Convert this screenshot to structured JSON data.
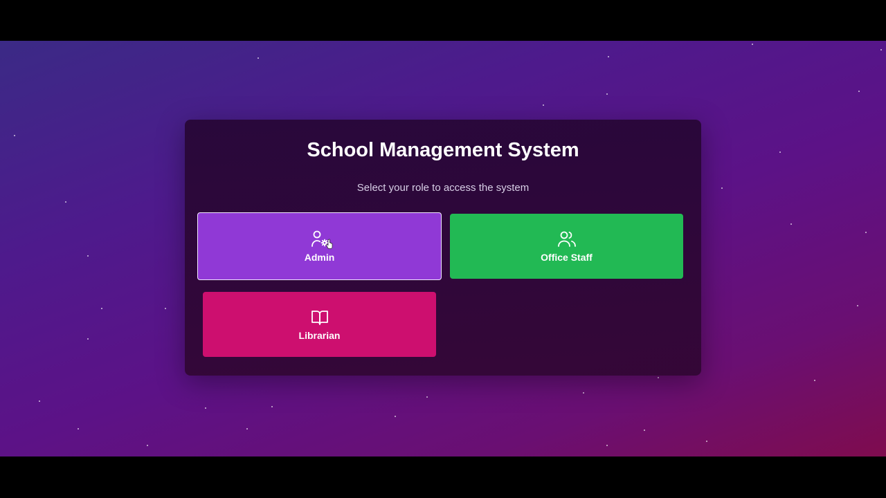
{
  "app": {
    "title": "School Management System",
    "subtitle": "Select your role to access the system"
  },
  "roles": [
    {
      "label": "Admin",
      "icon": "user-gear-icon",
      "color": "#9039d6"
    },
    {
      "label": "Office Staff",
      "icon": "users-icon",
      "color": "#22b954"
    },
    {
      "label": "Librarian",
      "icon": "open-book-icon",
      "color": "#cd0f6f"
    }
  ],
  "theme": {
    "background_gradient": [
      "#3b2a86",
      "#5c1287",
      "#7f0c4e"
    ],
    "card_background": "#2a0836",
    "text_primary": "#ffffff",
    "text_secondary": "#d8cfe6"
  }
}
